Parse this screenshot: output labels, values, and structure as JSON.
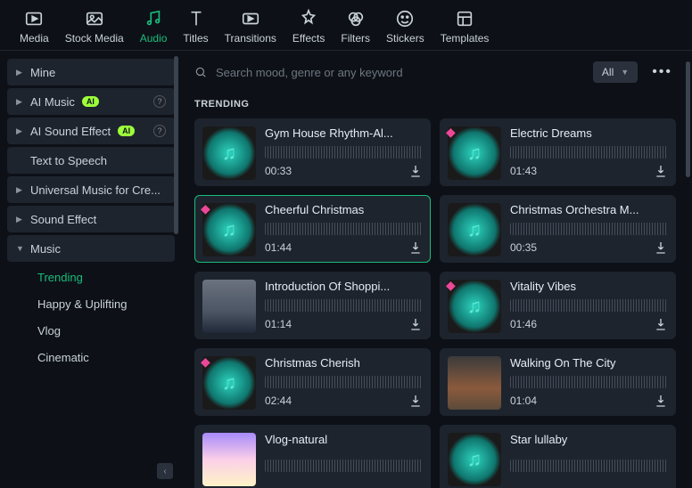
{
  "toolbar": {
    "items": [
      {
        "label": "Media"
      },
      {
        "label": "Stock Media"
      },
      {
        "label": "Audio",
        "active": true
      },
      {
        "label": "Titles"
      },
      {
        "label": "Transitions"
      },
      {
        "label": "Effects"
      },
      {
        "label": "Filters"
      },
      {
        "label": "Stickers"
      },
      {
        "label": "Templates"
      }
    ]
  },
  "sidebar": {
    "mine": "Mine",
    "ai_music": "AI Music",
    "ai_sound_effect": "AI Sound Effect",
    "tts": "Text to Speech",
    "universal": "Universal Music for Cre...",
    "sound_effect": "Sound Effect",
    "music": "Music",
    "sub": {
      "trending": "Trending",
      "happy": "Happy & Uplifting",
      "vlog": "Vlog",
      "cinematic": "Cinematic"
    }
  },
  "search": {
    "placeholder": "Search mood, genre or any keyword"
  },
  "filter": {
    "label": "All"
  },
  "section": {
    "trending": "TRENDING"
  },
  "tracks": [
    {
      "name": "Gym House Rhythm-Al...",
      "dur": "00:33",
      "gem": false,
      "thumb": "music"
    },
    {
      "name": "Electric Dreams",
      "dur": "01:43",
      "gem": true,
      "thumb": "music"
    },
    {
      "name": "Cheerful Christmas",
      "dur": "01:44",
      "gem": true,
      "thumb": "music",
      "selected": true
    },
    {
      "name": "Christmas Orchestra M...",
      "dur": "00:35",
      "gem": false,
      "thumb": "music"
    },
    {
      "name": "Introduction Of Shoppi...",
      "dur": "01:14",
      "gem": false,
      "thumb": "img1"
    },
    {
      "name": "Vitality Vibes",
      "dur": "01:46",
      "gem": true,
      "thumb": "music"
    },
    {
      "name": "Christmas Cherish",
      "dur": "02:44",
      "gem": true,
      "thumb": "music"
    },
    {
      "name": "Walking On The City",
      "dur": "01:04",
      "gem": false,
      "thumb": "img2"
    },
    {
      "name": "Vlog-natural",
      "dur": "",
      "gem": false,
      "thumb": "img3"
    },
    {
      "name": "Star lullaby",
      "dur": "",
      "gem": false,
      "thumb": "music"
    }
  ]
}
